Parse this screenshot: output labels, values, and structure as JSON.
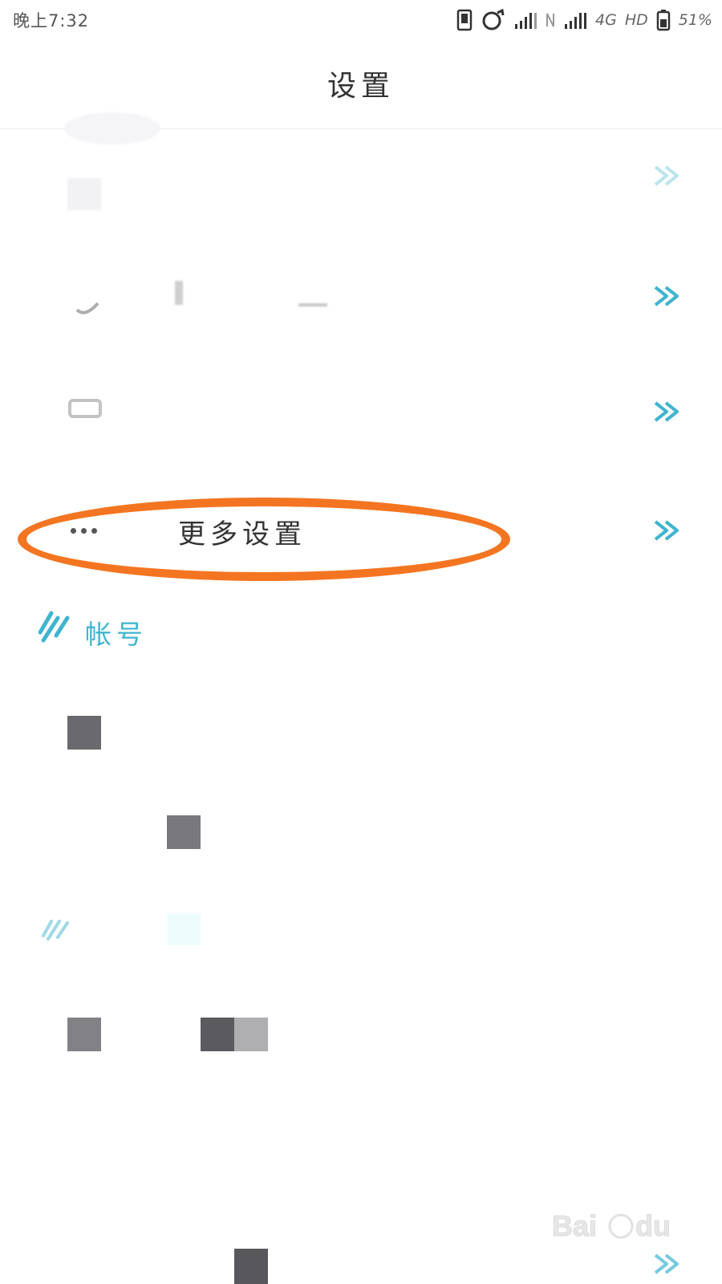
{
  "status_bar": {
    "time": "晚上7:32",
    "network": "4G",
    "hd": "HD",
    "battery": "51%",
    "icons": [
      "phone-icon",
      "alarm-icon",
      "signal-icon",
      "nfc-icon",
      "signal-icon",
      "battery-icon"
    ]
  },
  "header": {
    "title": "设置"
  },
  "settings": {
    "more_settings_label": "更多设置"
  },
  "sections": {
    "account_title": "帐号"
  },
  "colors": {
    "accent": "#3fb4cf",
    "highlight": "#f47521",
    "text": "#333333"
  }
}
